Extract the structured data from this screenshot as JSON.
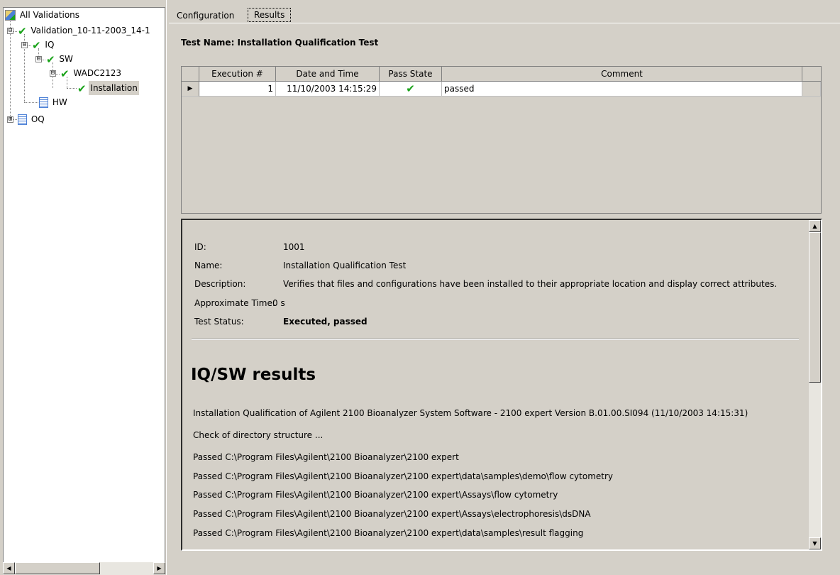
{
  "tree": {
    "root_label": "All Validations",
    "nodes": [
      {
        "label": "Validation_10-11-2003_14-1",
        "status": "passed"
      },
      {
        "label": "IQ",
        "status": "passed"
      },
      {
        "label": "SW",
        "status": "passed"
      },
      {
        "label": "WADC2123",
        "status": "passed"
      },
      {
        "label": "Installation",
        "status": "passed"
      },
      {
        "label": "HW",
        "status": "document"
      },
      {
        "label": "OQ",
        "status": "document"
      }
    ],
    "expanders": {
      "minus": "⊟",
      "plus": "⊞"
    }
  },
  "tabs": {
    "configuration": "Configuration",
    "results": "Results"
  },
  "test_title": "Test Name: Installation Qualification Test",
  "grid": {
    "columns": [
      "Execution #",
      "Date and Time",
      "Pass State",
      "Comment"
    ],
    "rows": [
      {
        "execution": "1",
        "datetime": "11/10/2003 14:15:29",
        "pass_state": "passed",
        "comment": "passed"
      }
    ]
  },
  "details": {
    "id_label": "ID:",
    "id_value": "1001",
    "name_label": "Name:",
    "name_value": "Installation Qualification Test",
    "description_label": "Description:",
    "description_value": "Verifies that files and configurations have been installed to their appropriate location and display correct attributes.",
    "time_label": "Approximate Time:",
    "time_value": "0 s",
    "status_label": "Test Status:",
    "status_value": "Executed, passed"
  },
  "results": {
    "heading": "IQ/SW results",
    "lines": [
      "Installation Qualification of Agilent 2100 Bioanalyzer System Software - 2100 expert Version B.01.00.SI094 (11/10/2003 14:15:31)",
      "Check of directory structure ...",
      "Passed C:\\Program Files\\Agilent\\2100 Bioanalyzer\\2100 expert",
      "Passed C:\\Program Files\\Agilent\\2100 Bioanalyzer\\2100 expert\\data\\samples\\demo\\flow cytometry",
      "Passed C:\\Program Files\\Agilent\\2100 Bioanalyzer\\2100 expert\\Assays\\flow cytometry",
      "Passed C:\\Program Files\\Agilent\\2100 Bioanalyzer\\2100 expert\\Assays\\electrophoresis\\dsDNA",
      "Passed C:\\Program Files\\Agilent\\2100 Bioanalyzer\\2100 expert\\data\\samples\\result flagging"
    ]
  },
  "icons": {
    "check": "✔",
    "row_pointer": "▶",
    "scroll_up": "▲",
    "scroll_down": "▼",
    "scroll_left": "◀",
    "scroll_right": "▶"
  },
  "colors": {
    "check": "#1aa31a",
    "window_bg": "#d4d0c8",
    "doc_icon": "#4a7fd6"
  }
}
